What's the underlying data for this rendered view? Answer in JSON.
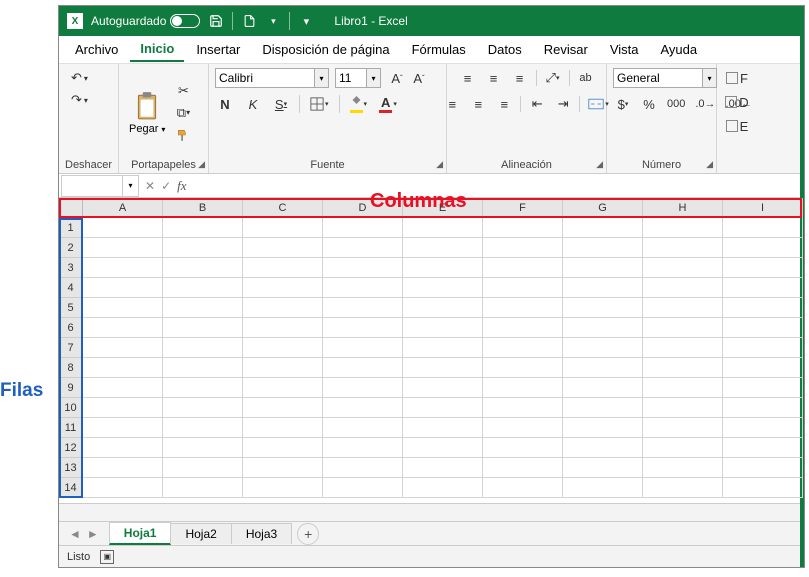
{
  "annotations": {
    "columnas": "Columnas",
    "filas": "Filas"
  },
  "titlebar": {
    "autosave_label": "Autoguardado",
    "doc_title": "Libro1  -  Excel"
  },
  "menu": {
    "items": [
      "Archivo",
      "Inicio",
      "Insertar",
      "Disposición de página",
      "Fórmulas",
      "Datos",
      "Revisar",
      "Vista",
      "Ayuda"
    ],
    "active_index": 1
  },
  "ribbon": {
    "undo_group": "Deshacer",
    "clipboard_group": "Portapapeles",
    "paste_label": "Pegar",
    "font_group": "Fuente",
    "font_name": "Calibri",
    "font_size": "11",
    "bold": "N",
    "italic": "K",
    "underline": "S",
    "alignment_group": "Alineación",
    "wrap_label": "ab",
    "number_group": "Número",
    "number_format": "General",
    "currency": "$",
    "percent": "%",
    "thousands": "000",
    "styles": {
      "f": "F",
      "d": "D",
      "e": "E"
    }
  },
  "formula_bar": {
    "cancel": "✕",
    "confirm": "✓",
    "fx": "fx"
  },
  "columns": [
    "A",
    "B",
    "C",
    "D",
    "E",
    "F",
    "G",
    "H",
    "I"
  ],
  "rows": [
    "1",
    "2",
    "3",
    "4",
    "5",
    "6",
    "7",
    "8",
    "9",
    "10",
    "11",
    "12",
    "13",
    "14"
  ],
  "sheets": {
    "tabs": [
      "Hoja1",
      "Hoja2",
      "Hoja3"
    ],
    "active_index": 0
  },
  "status": {
    "ready": "Listo"
  }
}
